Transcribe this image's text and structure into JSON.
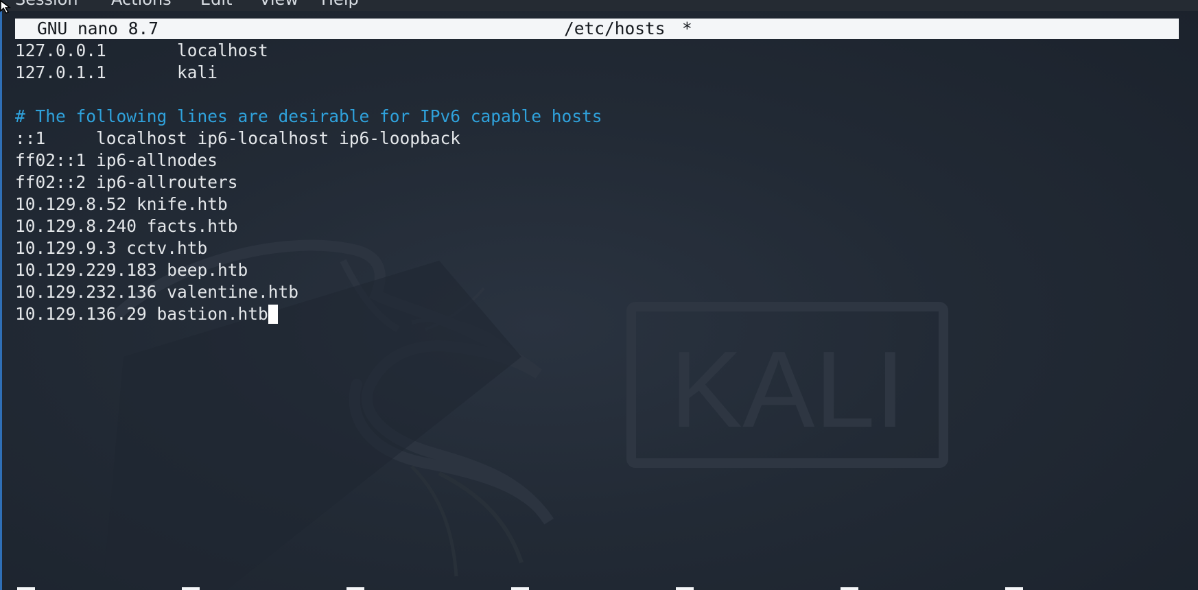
{
  "menubar": {
    "items": [
      "Session",
      "Actions",
      "Edit",
      "View",
      "Help"
    ]
  },
  "nano": {
    "version": "GNU nano 8.7",
    "filename": "/etc/hosts",
    "modified_marker": "*"
  },
  "file_lines": [
    "127.0.0.1       localhost",
    "127.0.1.1       kali",
    "",
    "# The following lines are desirable for IPv6 capable hosts",
    "::1     localhost ip6-localhost ip6-loopback",
    "ff02::1 ip6-allnodes",
    "ff02::2 ip6-allrouters",
    "10.129.8.52 knife.htb",
    "10.129.8.240 facts.htb",
    "10.129.9.3 cctv.htb",
    "10.129.229.183 beep.htb",
    "10.129.232.136 valentine.htb",
    "10.129.136.29 bastion.htb"
  ],
  "watermark": {
    "text": "KALI"
  },
  "colors": {
    "background": "#1b222c",
    "text": "#e4e7ea",
    "comment": "#2fa2dc",
    "header_bg": "#f4f6f8",
    "window_border": "#2f6fb6"
  }
}
